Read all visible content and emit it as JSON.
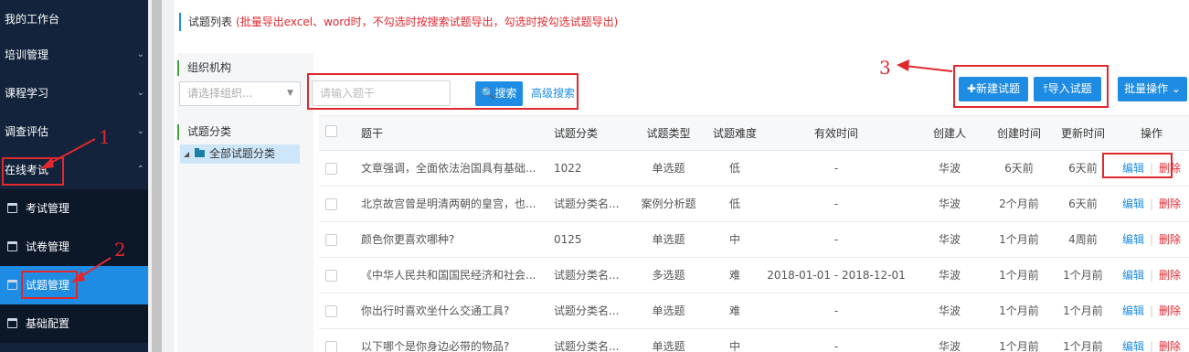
{
  "sidebar": {
    "items": [
      {
        "label": "我的工作台",
        "chevron": ""
      },
      {
        "label": "培训管理",
        "chevron": "⌄"
      },
      {
        "label": "课程学习",
        "chevron": "⌄"
      },
      {
        "label": "调查评估",
        "chevron": "⌄"
      },
      {
        "label": "在线考试",
        "chevron": "⌃"
      }
    ],
    "sub_items": [
      {
        "label": "考试管理",
        "icon": "calendar-icon"
      },
      {
        "label": "试卷管理",
        "icon": "calendar-icon"
      },
      {
        "label": "试题管理",
        "icon": "calendar-icon",
        "active": true
      },
      {
        "label": "基础配置",
        "icon": "calendar-icon"
      }
    ]
  },
  "header": {
    "title": "试题列表",
    "note": "(批量导出excel、word时，不勾选时按搜索试题导出，勾选时按勾选试题导出)"
  },
  "left_panel": {
    "org_heading": "组织机构",
    "org_placeholder": "请选择组织...",
    "category_heading": "试题分类",
    "tree_root": "全部试题分类"
  },
  "search": {
    "placeholder": "请输入题干",
    "button": "🔍搜索",
    "advanced": "高级搜索"
  },
  "toolbar": {
    "new_label": "✚新建试题",
    "import_label": "⤒导入试题",
    "batch_label": "批量操作 ⌄"
  },
  "table": {
    "headers": [
      "题干",
      "试题分类",
      "试题类型",
      "试题难度",
      "有效时间",
      "创建人",
      "创建时间",
      "更新时间",
      "操作"
    ],
    "rows": [
      {
        "stem": "文章强调，全面依法治国具有基础...",
        "category": "1022",
        "type": "单选题",
        "difficulty": "低",
        "valid": "-",
        "creator": "华波",
        "created": "6天前",
        "updated": "6天前"
      },
      {
        "stem": "北京故宫曾是明清两朝的皇宫，也...",
        "category": "试题分类名...",
        "type": "案例分析题",
        "difficulty": "低",
        "valid": "-",
        "creator": "华波",
        "created": "2个月前",
        "updated": "6天前"
      },
      {
        "stem": "颜色你更喜欢哪种?",
        "category": "0125",
        "type": "单选题",
        "difficulty": "中",
        "valid": "-",
        "creator": "华波",
        "created": "1个月前",
        "updated": "4周前"
      },
      {
        "stem": "《中华人民共和国国民经济和社会...",
        "category": "试题分类名...",
        "type": "多选题",
        "difficulty": "难",
        "valid": "2018-01-01 - 2018-12-01",
        "creator": "华波",
        "created": "1个月前",
        "updated": "1个月前"
      },
      {
        "stem": "你出行时喜欢坐什么交通工具?",
        "category": "试题分类名...",
        "type": "单选题",
        "difficulty": "难",
        "valid": "-",
        "creator": "华波",
        "created": "1个月前",
        "updated": "1个月前"
      },
      {
        "stem": "以下哪个是你身边必带的物品?",
        "category": "试题分类名...",
        "type": "单选题",
        "difficulty": "中",
        "valid": "-",
        "creator": "华波",
        "created": "1个月前",
        "updated": "1个月前"
      }
    ],
    "edit_label": "编辑",
    "sep": "|",
    "delete_label": "删除"
  },
  "annotations": {
    "n1": "1",
    "n2": "2",
    "n3": "3"
  },
  "colors": {
    "sidebar_bg": "#13233b",
    "accent": "#1f8ce4",
    "annotation_red": "#e0282f"
  }
}
